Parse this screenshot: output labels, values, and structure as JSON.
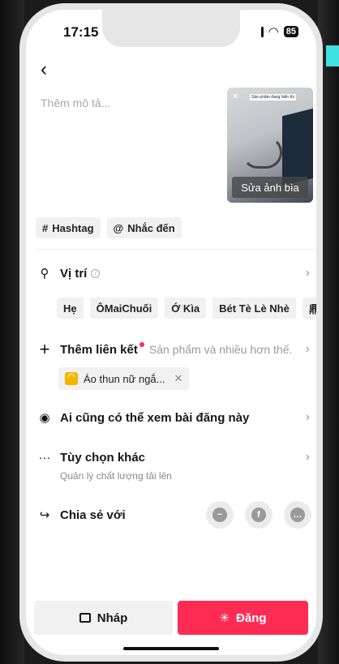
{
  "status": {
    "time": "17:15",
    "battery": "85"
  },
  "header": {
    "back_icon": "chevron-left-icon"
  },
  "post": {
    "description_placeholder": "Thêm mô tả...",
    "cover_caption": "Sản phẩm đang hiển thị",
    "edit_cover_label": "Sửa ảnh bìa"
  },
  "chips": {
    "hashtag": "Hashtag",
    "mention": "Nhắc đến"
  },
  "location": {
    "label": "Vị trí",
    "tags": [
      "Hẹ",
      "ÔMaiChuối",
      "Ớ Kìa",
      "Bét Tè Lè Nhè",
      "鼎丰水"
    ]
  },
  "link": {
    "label": "Thêm liên kết",
    "hint": "Sản phẩm và nhiều hơn thế.",
    "product": "Áo thun nữ ngắ..."
  },
  "privacy": {
    "label": "Ai cũng có thể xem bài đăng này"
  },
  "more": {
    "label": "Tùy chọn khác",
    "sub": "Quản lý chất lượng tải lên"
  },
  "share": {
    "label": "Chia sẻ với"
  },
  "actions": {
    "draft": "Nháp",
    "post": "Đăng"
  },
  "colors": {
    "accent": "#fe2c55",
    "chip_bg": "#f1f1f2"
  }
}
